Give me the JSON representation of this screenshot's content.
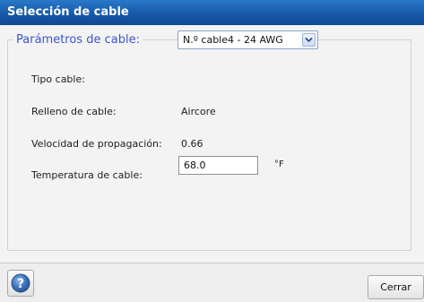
{
  "window": {
    "title": "Selección de cable"
  },
  "group": {
    "legend": "Parámetros de cable:"
  },
  "fields": {
    "tipo_cable": {
      "label": "Tipo cable:",
      "value": "N.º cable4 - 24 AWG"
    },
    "relleno": {
      "label": "Relleno de cable:",
      "value": "Aircore"
    },
    "velocidad": {
      "label": "Velocidad de propagación:",
      "value": "0.66"
    },
    "temperatura": {
      "label": "Temperatura de cable:",
      "value": "68.0",
      "unit": "°F"
    }
  },
  "footer": {
    "close_label": "Cerrar"
  },
  "icons": {
    "help": "help-icon",
    "dropdown": "chevron-down-icon"
  },
  "colors": {
    "titlebar": "#1659a8",
    "legend": "#3c56c8"
  }
}
